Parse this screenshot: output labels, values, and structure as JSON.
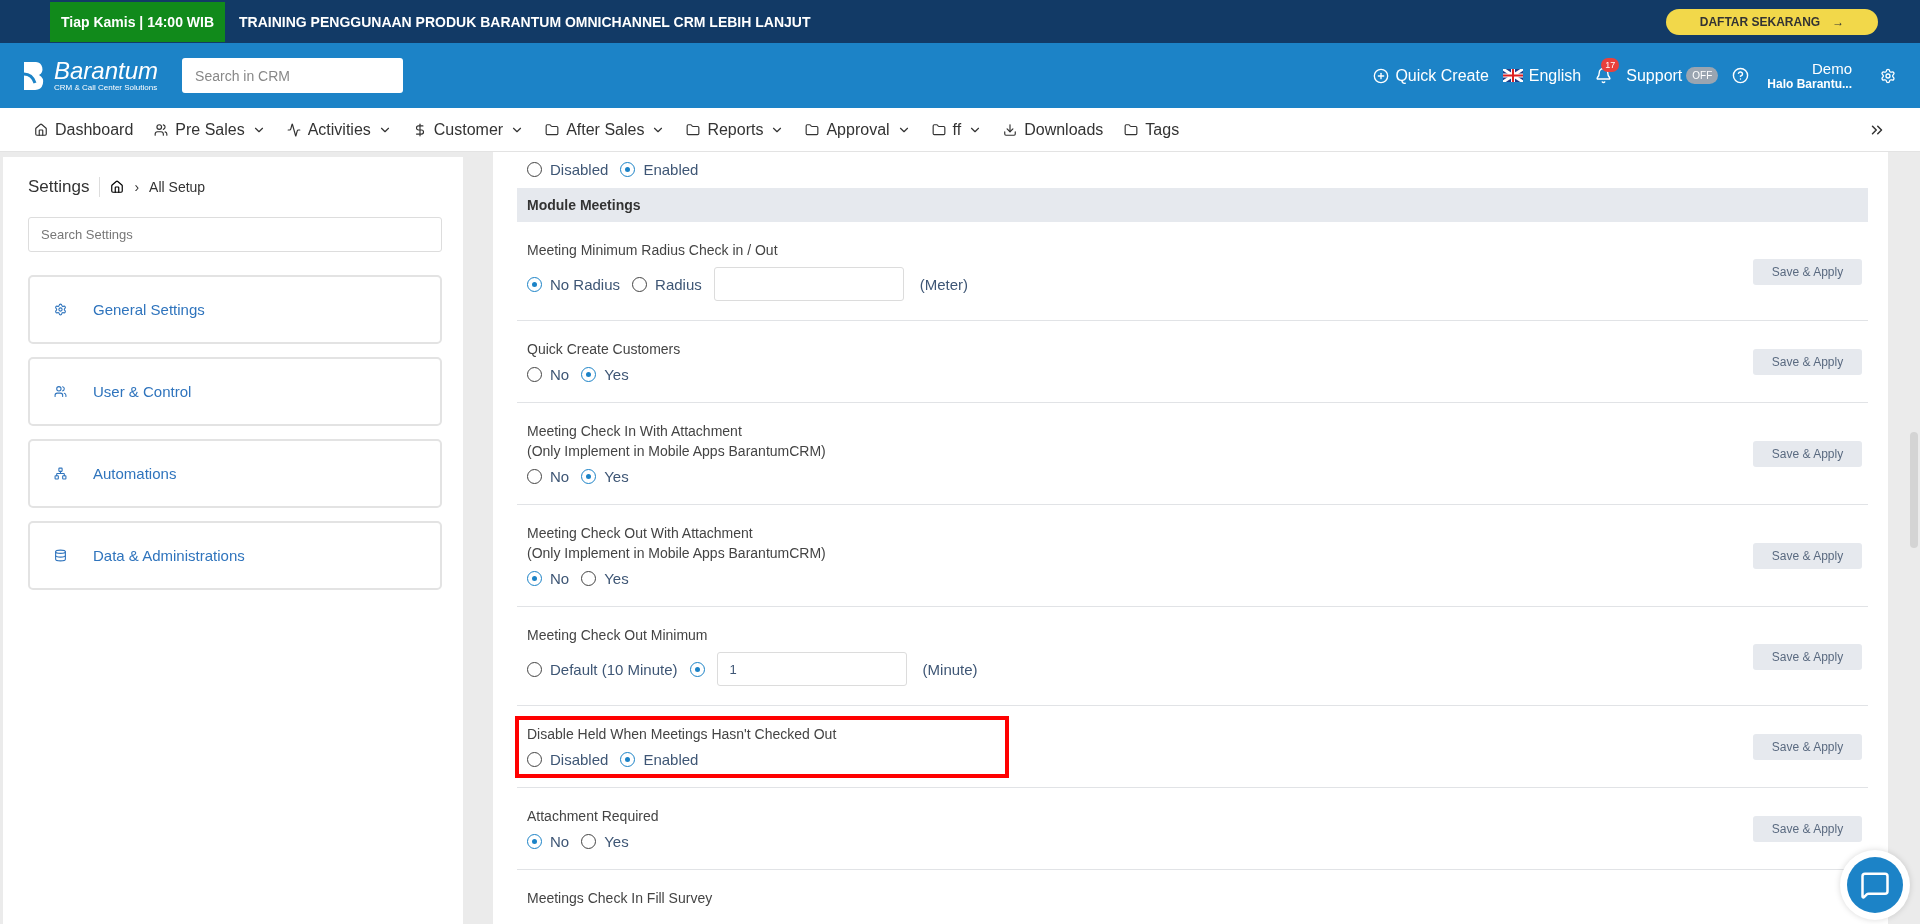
{
  "banner": {
    "badge": "Tiap Kamis | 14:00 WIB",
    "headline": "TRAINING PENGGUNAAN PRODUK BARANTUM OMNICHANNEL CRM LEBIH LANJUT",
    "cta": "DAFTAR SEKARANG",
    "cta_arrow": "→"
  },
  "header": {
    "logo": {
      "name": "Barantum",
      "tagline": "CRM & Call Center Solutions"
    },
    "search": {
      "placeholder": "Search in CRM"
    },
    "quick_create": "Quick Create",
    "language": "English",
    "notifications": "17",
    "support": {
      "label": "Support",
      "toggle": "OFF",
      "on": false
    },
    "user": {
      "name": "Demo",
      "greeting": "Halo Barantu..."
    }
  },
  "nav": [
    {
      "label": "Dashboard",
      "dropdown": false
    },
    {
      "label": "Pre Sales",
      "dropdown": true
    },
    {
      "label": "Activities",
      "dropdown": true
    },
    {
      "label": "Customer",
      "dropdown": true
    },
    {
      "label": "After Sales",
      "dropdown": true
    },
    {
      "label": "Reports",
      "dropdown": true
    },
    {
      "label": "Approval",
      "dropdown": true
    },
    {
      "label": "ff",
      "dropdown": true
    },
    {
      "label": "Downloads",
      "dropdown": false
    },
    {
      "label": "Tags",
      "dropdown": false
    }
  ],
  "sidebar": {
    "title": "Settings",
    "breadcrumb_separator": "›",
    "breadcrumb": "All Setup",
    "search": {
      "placeholder": "Search Settings"
    },
    "items": [
      {
        "label": "General Settings"
      },
      {
        "label": "User & Control"
      },
      {
        "label": "Automations"
      },
      {
        "label": "Data & Administrations"
      }
    ]
  },
  "top_options": [
    {
      "kind": "radio",
      "label": "Disabled",
      "selected": false
    },
    {
      "kind": "radio",
      "label": "Enabled",
      "selected": true
    }
  ],
  "section": "Module Meetings",
  "settings": [
    {
      "title": "Meeting Minimum Radius Check in / Out",
      "highlighted": false,
      "button": "Save & Apply",
      "options": [
        {
          "kind": "radio",
          "label": "No Radius",
          "selected": true
        },
        {
          "kind": "radio",
          "label": "Radius",
          "selected": false
        },
        {
          "kind": "input"
        },
        {
          "kind": "unit",
          "text": "(Meter)"
        }
      ]
    },
    {
      "title": "Quick Create Customers",
      "highlighted": false,
      "button": "Save & Apply",
      "options": [
        {
          "kind": "radio",
          "label": "No",
          "selected": false
        },
        {
          "kind": "radio",
          "label": "Yes",
          "selected": true
        }
      ]
    },
    {
      "title": "Meeting Check In With Attachment",
      "note": "(Only Implement in Mobile Apps BarantumCRM)",
      "highlighted": false,
      "button": "Save & Apply",
      "options": [
        {
          "kind": "radio",
          "label": "No",
          "selected": false
        },
        {
          "kind": "radio",
          "label": "Yes",
          "selected": true
        }
      ]
    },
    {
      "title": "Meeting Check Out With Attachment",
      "note": "(Only Implement in Mobile Apps BarantumCRM)",
      "highlighted": false,
      "button": "Save & Apply",
      "options": [
        {
          "kind": "radio",
          "label": "No",
          "selected": true
        },
        {
          "kind": "radio",
          "label": "Yes",
          "selected": false
        }
      ]
    },
    {
      "title": "Meeting Check Out Minimum",
      "highlighted": false,
      "button": "Save & Apply",
      "options": [
        {
          "kind": "radio",
          "label": "Default (10 Minute)",
          "selected": false
        },
        {
          "kind": "radio",
          "selected": true
        },
        {
          "kind": "input",
          "value": "1"
        },
        {
          "kind": "unit",
          "text": "(Minute)"
        }
      ]
    },
    {
      "title": "Disable Held When Meetings Hasn't Checked Out",
      "highlighted": true,
      "button": "Save & Apply",
      "options": [
        {
          "kind": "radio",
          "label": "Disabled",
          "selected": false
        },
        {
          "kind": "radio",
          "label": "Enabled",
          "selected": true
        }
      ]
    },
    {
      "title": "Attachment Required",
      "highlighted": false,
      "button": "Save & Apply",
      "options": [
        {
          "kind": "radio",
          "label": "No",
          "selected": true
        },
        {
          "kind": "radio",
          "label": "Yes",
          "selected": false
        }
      ]
    },
    {
      "title": "Meetings Check In Fill Survey",
      "highlighted": false
    }
  ]
}
